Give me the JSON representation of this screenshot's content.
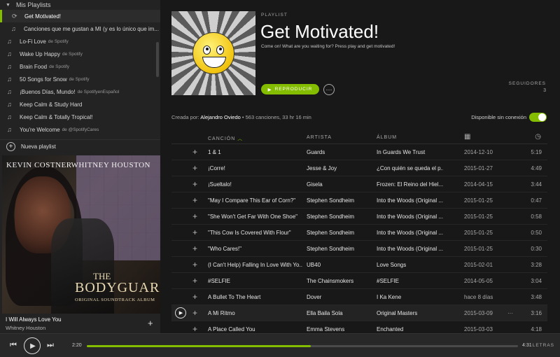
{
  "sidebar": {
    "section_label": "Mis Playlists",
    "items": [
      {
        "label": "Get Motivated!",
        "by": "",
        "icon": "sync-icon",
        "active": true
      },
      {
        "label": "Canciones que me gustan a MI (y es lo único que im...",
        "by": "",
        "icon": "music-note-icon",
        "active": false
      },
      {
        "label": "Lo-Fi Love",
        "by": "de Spotify",
        "icon": "music-note-icon",
        "active": false
      },
      {
        "label": "Wake Up Happy",
        "by": "de Spotify",
        "icon": "music-note-icon",
        "active": false
      },
      {
        "label": "Brain Food",
        "by": "de Spotify",
        "icon": "music-note-icon",
        "active": false
      },
      {
        "label": "50 Songs for Snow",
        "by": "de Spotify",
        "icon": "music-note-icon",
        "active": false
      },
      {
        "label": "¡Buenos Días, Mundo!",
        "by": "de SpotifyenEspañol",
        "icon": "music-note-icon",
        "active": false
      },
      {
        "label": "Keep Calm & Study Hard",
        "by": "",
        "icon": "music-note-icon",
        "active": false
      },
      {
        "label": "Keep Calm & Totally Tropical!",
        "by": "",
        "icon": "music-note-icon",
        "active": false
      },
      {
        "label": "You're Welcome",
        "by": "de @SpotifyCares",
        "icon": "music-note-icon",
        "active": false
      }
    ],
    "new_playlist": "Nueva playlist"
  },
  "album_art": {
    "actor": "KEVIN COSTNER",
    "actress": "WHITNEY HOUSTON",
    "the": "THE",
    "title": "BODYGUARD",
    "subtitle": "ORIGINAL SOUNDTRACK ALBUM"
  },
  "now_playing": {
    "title": "I Will Always Love You",
    "artist": "Whitney Houston"
  },
  "playlist": {
    "label": "PLAYLIST",
    "title": "Get Motivated!",
    "description": "Come on! What are you waiting for? Press play and get motivated!",
    "play_label": "REPRODUCIR",
    "followers_label": "SEGUIDORES",
    "followers_count": "3",
    "created_by_label": "Creada por:",
    "owner": "Alejandro Oviedo",
    "stats": "• 563 canciones, 33 hr 16 min",
    "offline_label": "Disponible sin conexión"
  },
  "table": {
    "headers": {
      "song": "CANCIÓN",
      "artist": "ARTISTA",
      "album": "ÁLBUM"
    },
    "rows": [
      {
        "song": "1 & 1",
        "artist": "Guards",
        "album": "In Guards We Trust",
        "date": "2014-12-10",
        "duration": "5:19"
      },
      {
        "song": "¡Corre!",
        "artist": "Jesse & Joy",
        "album": "¿Con quién se queda el p...",
        "date": "2015-01-27",
        "duration": "4:49"
      },
      {
        "song": "¡Sueltalo!",
        "artist": "Gisela",
        "album": "Frozen: El Reino del Hiel...",
        "date": "2014-04-15",
        "duration": "3:44"
      },
      {
        "song": "\"May I Compare This Ear of Corn?\"",
        "artist": "Stephen Sondheim",
        "album": "Into the Woods (Original ...",
        "date": "2015-01-25",
        "duration": "0:47"
      },
      {
        "song": "\"She Won't Get Far With One Shoe\"",
        "artist": "Stephen Sondheim",
        "album": "Into the Woods (Original ...",
        "date": "2015-01-25",
        "duration": "0:58"
      },
      {
        "song": "\"This Cow Is Covered With Flour\"",
        "artist": "Stephen Sondheim",
        "album": "Into the Woods (Original ...",
        "date": "2015-01-25",
        "duration": "0:50"
      },
      {
        "song": "\"Who Cares!\"",
        "artist": "Stephen Sondheim",
        "album": "Into the Woods (Original ...",
        "date": "2015-01-25",
        "duration": "0:30"
      },
      {
        "song": "(I Can't Help) Falling In Love With Yo...",
        "artist": "UB40",
        "album": "Love Songs",
        "date": "2015-02-01",
        "duration": "3:28"
      },
      {
        "song": "#SELFIE",
        "artist": "The Chainsmokers",
        "album": "#SELFIE",
        "date": "2014-05-05",
        "duration": "3:04"
      },
      {
        "song": "A Bullet To The Heart",
        "artist": "Dover",
        "album": "I Ka Kene",
        "date": "hace 8 días",
        "duration": "3:48"
      },
      {
        "song": "A Mi Ritmo",
        "artist": "Ella Baila Sola",
        "album": "Original Masters",
        "date": "2015-03-09",
        "duration": "3:16",
        "hover": true
      },
      {
        "song": "A Place Called You",
        "artist": "Emma Stevens",
        "album": "Enchanted",
        "date": "2015-03-03",
        "duration": "4:18"
      }
    ]
  },
  "player": {
    "elapsed": "2:20",
    "duration": "4:31",
    "progress": 0.52,
    "lyrics_label": "LETRAS"
  },
  "colors": {
    "accent": "#84bd00",
    "background": "#181818",
    "sidebar": "#232323"
  }
}
